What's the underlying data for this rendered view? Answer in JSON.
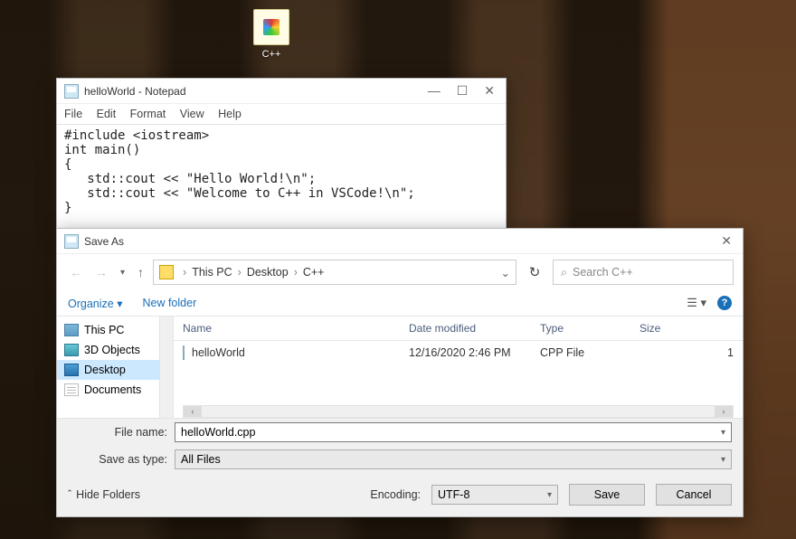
{
  "desktop": {
    "icon_label": "C++"
  },
  "notepad": {
    "title": "helloWorld - Notepad",
    "menu": {
      "file": "File",
      "edit": "Edit",
      "format": "Format",
      "view": "View",
      "help": "Help"
    },
    "code": "#include <iostream>\nint main()\n{\n   std::cout << \"Hello World!\\n\";\n   std::cout << \"Welcome to C++ in VSCode!\\n\";\n}"
  },
  "saveas": {
    "title": "Save As",
    "breadcrumb": {
      "p0": "This PC",
      "p1": "Desktop",
      "p2": "C++"
    },
    "search_placeholder": "Search C++",
    "toolbar": {
      "organize": "Organize",
      "newfolder": "New folder"
    },
    "tree": {
      "thispc": "This PC",
      "objects": "3D Objects",
      "desktop": "Desktop",
      "documents": "Documents"
    },
    "columns": {
      "name": "Name",
      "date": "Date modified",
      "type": "Type",
      "size": "Size"
    },
    "files": [
      {
        "name": "helloWorld",
        "date": "12/16/2020 2:46 PM",
        "type": "CPP File",
        "size": "1"
      }
    ],
    "labels": {
      "filename": "File name:",
      "saveastype": "Save as type:",
      "encoding": "Encoding:",
      "hidefolders": "Hide Folders",
      "save": "Save",
      "cancel": "Cancel"
    },
    "filename_value": "helloWorld.cpp",
    "saveastype_value": "All Files",
    "encoding_value": "UTF-8"
  }
}
